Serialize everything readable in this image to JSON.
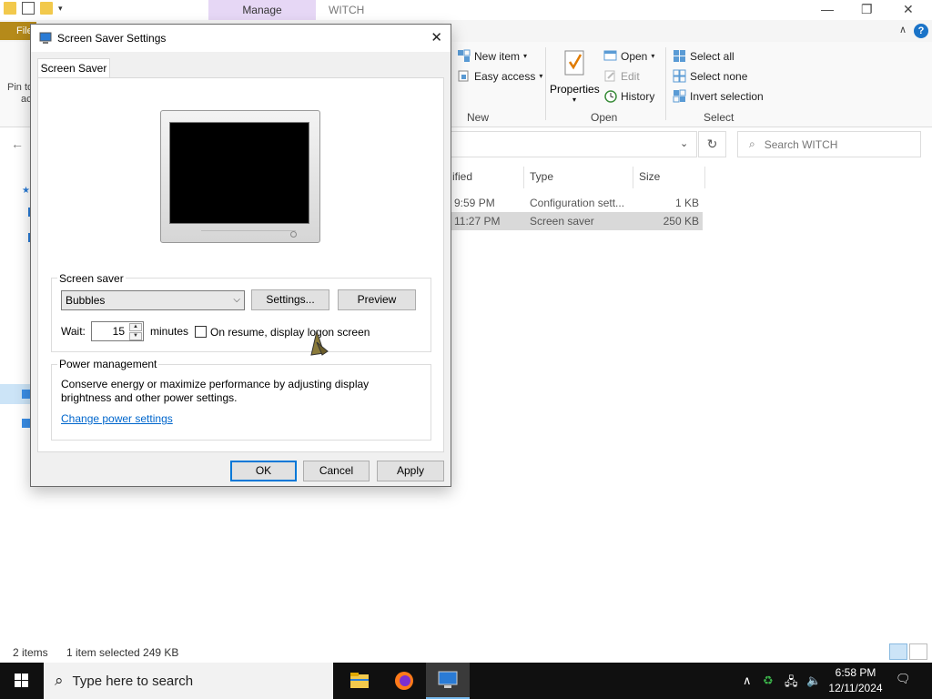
{
  "explorer": {
    "title": "WITCH",
    "manage_tab": "Manage",
    "file_tab": "File",
    "pin_label": "Pin to",
    "pin_label2": "ac",
    "ribbon": {
      "new_item": "New item",
      "easy_access": "Easy access",
      "properties": "Properties",
      "open": "Open",
      "edit": "Edit",
      "history": "History",
      "select_all": "Select all",
      "select_none": "Select none",
      "invert_selection": "Invert selection",
      "group_new": "New",
      "group_open": "Open",
      "group_select": "Select"
    },
    "search_placeholder": "Search WITCH",
    "columns": {
      "modified": "ified",
      "type": "Type",
      "size": "Size"
    },
    "rows": [
      {
        "modified": "9:59 PM",
        "type": "Configuration sett...",
        "size": "1 KB",
        "selected": false
      },
      {
        "modified": "11:27 PM",
        "type": "Screen saver",
        "size": "250 KB",
        "selected": true
      }
    ],
    "status": {
      "items": "2 items",
      "selected": "1 item selected  249 KB"
    }
  },
  "dialog": {
    "title": "Screen Saver Settings",
    "tab": "Screen Saver",
    "screen_saver_group": "Screen saver",
    "selected_saver": "Bubbles",
    "settings_button": "Settings...",
    "preview_button": "Preview",
    "wait_label": "Wait:",
    "wait_value": "15",
    "minutes_label": "minutes",
    "resume_label": "On resume, display logon screen",
    "resume_checked": false,
    "power_group": "Power management",
    "power_text": "Conserve energy or maximize performance by adjusting display brightness and other power settings.",
    "power_link": "Change power settings",
    "ok": "OK",
    "cancel": "Cancel",
    "apply": "Apply"
  },
  "taskbar": {
    "search_placeholder": "Type here to search",
    "time": "6:58 PM",
    "date": "12/11/2024"
  },
  "colors": {
    "accent": "#0078d7",
    "manage_tab": "#e6d7f5",
    "file_tab": "#b58a1a"
  }
}
